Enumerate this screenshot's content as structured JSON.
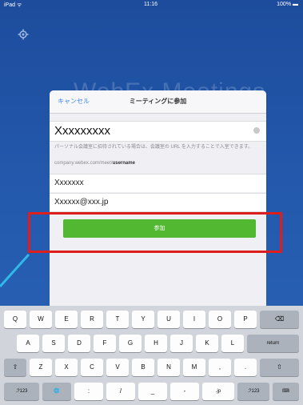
{
  "status_bar": {
    "carrier": "iPad ᯤ",
    "time": "11:16",
    "battery": "100% ▬"
  },
  "background_title": "WebEx Meetings",
  "dialog": {
    "cancel_label": "キャンセル",
    "title": "ミーティングに参加",
    "meeting_input_value": "Xxxxxxxxx",
    "hint_text": "パーソナル会議室に招待されている場合は、会議室の URL を入力することで入室できます。",
    "hint_example_prefix": "company.webex.com/meet/",
    "hint_example_bold": "username",
    "name_value": "Xxxxxxx",
    "email_value": "Xxxxxx@xxx.jp",
    "join_label": "参加"
  },
  "colors": {
    "join_button": "#52b832",
    "highlight": "#e01d1d",
    "accent": "#3a86f0"
  },
  "keyboard": {
    "row1": [
      "Q",
      "W",
      "E",
      "R",
      "T",
      "Y",
      "U",
      "I",
      "O",
      "P"
    ],
    "row2": [
      "A",
      "S",
      "D",
      "F",
      "G",
      "H",
      "J",
      "K",
      "L"
    ],
    "row3": [
      "Z",
      "X",
      "C",
      "V",
      "B",
      "N",
      "M",
      ",",
      "."
    ],
    "backspace": "⌫",
    "return": "return",
    "shift": "⇧",
    "numbers": ".?123",
    "globe": "🌐",
    "colon": ":",
    "slash": "/",
    "underscore": "_",
    "dash": "-",
    "jp": ".jp",
    "hide": "⌨"
  }
}
